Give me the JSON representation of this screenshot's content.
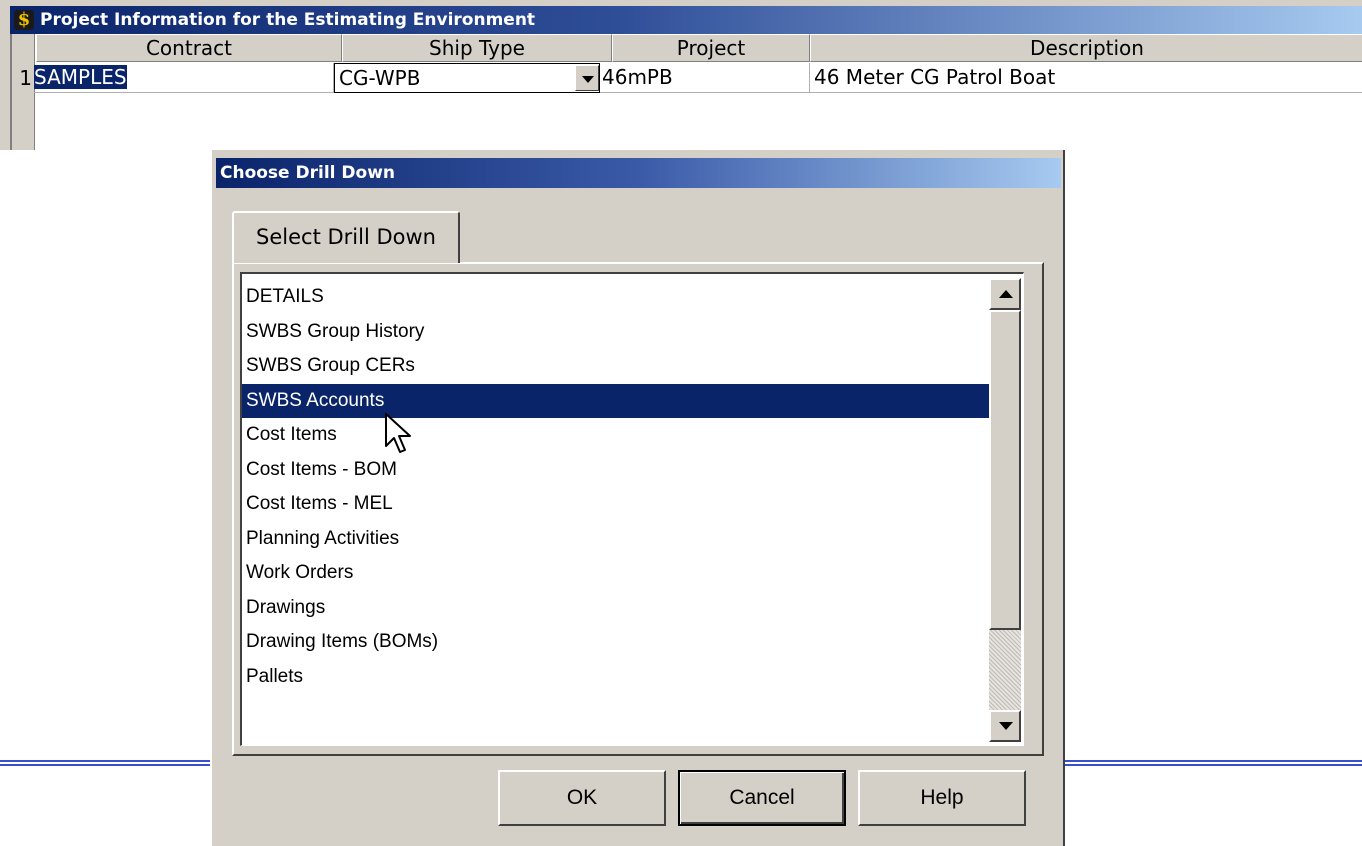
{
  "project_window": {
    "title": "Project Information for the Estimating Environment",
    "app_icon_glyph": "$",
    "columns": [
      "Contract",
      "Ship Type",
      "Project",
      "Description"
    ],
    "rows": [
      {
        "row_number": "1",
        "contract": "SAMPLES",
        "ship_type": "CG-WPB",
        "project": "46mPB",
        "description": "46 Meter CG Patrol Boat"
      }
    ]
  },
  "dialog": {
    "title": "Choose Drill Down",
    "tab_label": "Select Drill Down",
    "items": [
      "DETAILS",
      "SWBS Group History",
      "SWBS Group CERs",
      "SWBS Accounts",
      "Cost Items",
      "Cost Items - BOM",
      "Cost Items - MEL",
      "Planning Activities",
      "Work Orders",
      "Drawings",
      "Drawing Items (BOMs)",
      "Pallets"
    ],
    "selected_item": "SWBS Accounts",
    "buttons": {
      "ok": "OK",
      "cancel": "Cancel",
      "help": "Help"
    }
  },
  "colors": {
    "selection": "#0a246a",
    "window_face": "#d4d0c8",
    "rule_line": "#3a4fd0"
  },
  "icons": {
    "app_icon": "dollar-sign-icon",
    "combo_dropdown": "chevron-down-icon",
    "scroll_up": "scroll-up-arrow-icon",
    "scroll_down": "scroll-down-arrow-icon",
    "cursor": "mouse-pointer-icon"
  }
}
